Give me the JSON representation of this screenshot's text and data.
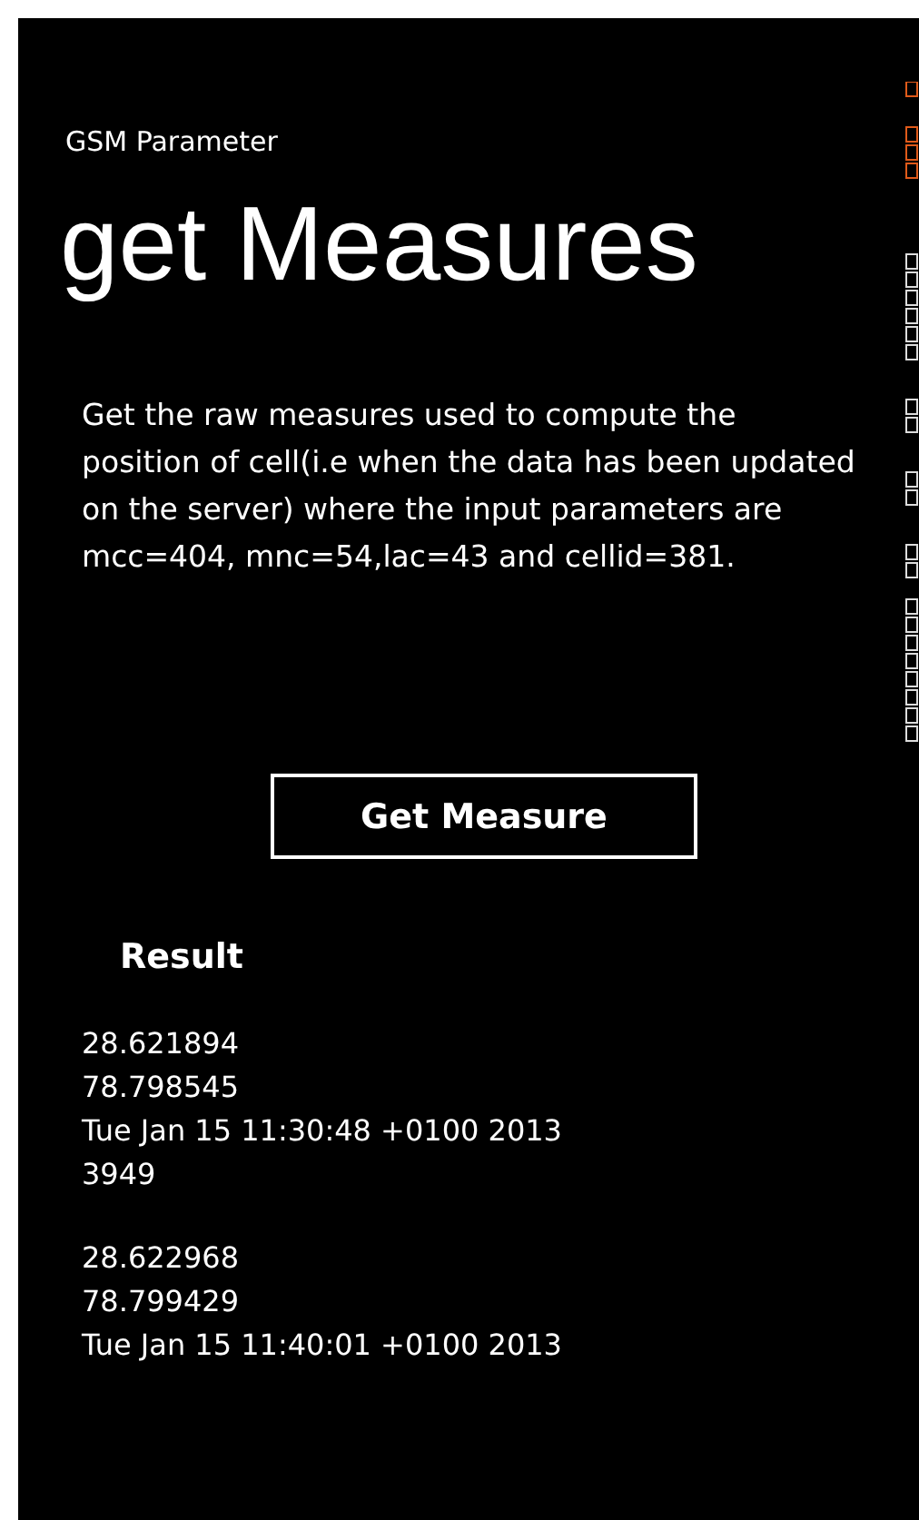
{
  "app_title": "GSM Parameter",
  "page_title": "get Measures",
  "description": "Get the raw measures used to compute the position of cell(i.e when the data  has been updated on the server) where the input parameters are mcc=404, mnc=54,lac=43 and cellid=381.",
  "button": "Get Measure",
  "result_heading": "Result",
  "results": [
    {
      "lines": [
        "28.621894",
        "78.798545",
        "Tue Jan 15 11:30:48 +0100 2013",
        "3949"
      ]
    },
    {
      "lines": [
        "28.622968",
        "78.799429",
        "Tue Jan 15 11:40:01 +0100 2013"
      ]
    }
  ]
}
